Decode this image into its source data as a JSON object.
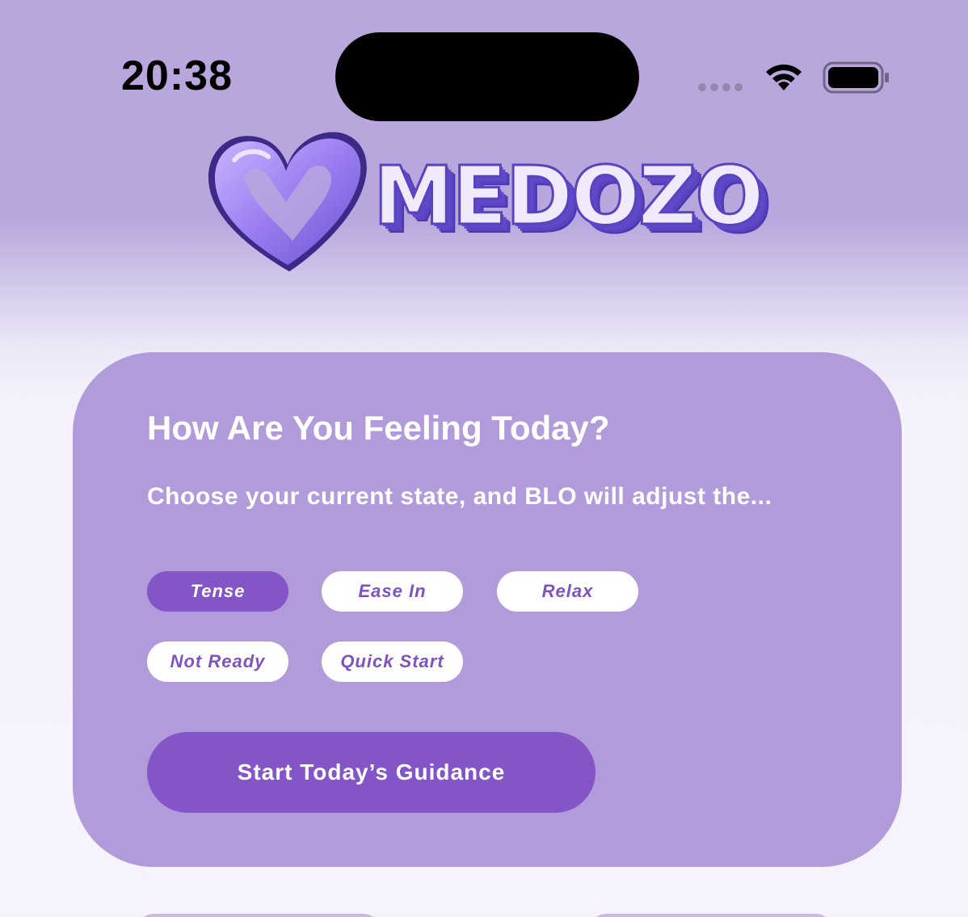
{
  "status_bar": {
    "time": "20:38",
    "icons": [
      "signal-dots-icon",
      "wifi-icon",
      "battery-icon"
    ]
  },
  "logo": {
    "text": "MEDOZO",
    "icon": "heart-logo-icon"
  },
  "mood_card": {
    "title": "How Are You Feeling Today?",
    "subtitle": "Choose your current state, and BLO will adjust the...",
    "options": [
      {
        "label": "Tense",
        "selected": true
      },
      {
        "label": "Ease In",
        "selected": false
      },
      {
        "label": "Relax",
        "selected": false
      },
      {
        "label": "Not Ready",
        "selected": false
      },
      {
        "label": "Quick Start",
        "selected": false
      }
    ],
    "start_label": "Start Today’s Guidance"
  },
  "colors": {
    "accent": "#8455c7",
    "card": "#b19bdb",
    "header_bg": "#b8a6dd",
    "page_bg": "#f6f3fd"
  }
}
